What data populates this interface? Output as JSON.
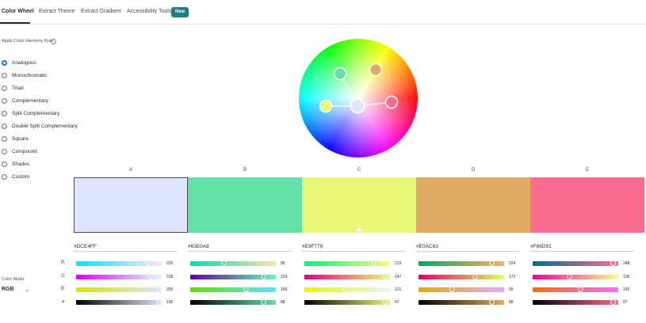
{
  "tabs": {
    "color_wheel": "Color Wheel",
    "extract_theme": "Extract Theme",
    "extract_gradient": "Extract Gradient",
    "accessibility_tools": "Accessibility Tools",
    "new_badge": "New"
  },
  "harmony": {
    "label": "Apply Color Harmony Rule",
    "info": "i",
    "selected": "Analogous",
    "rules": [
      "Analogous",
      "Monochromatic",
      "Triad",
      "Complementary",
      "Split Complementary",
      "Double Split Complementary",
      "Square",
      "Compound",
      "Shades",
      "Custom"
    ]
  },
  "swatches": [
    {
      "label": "A",
      "hex": "#DCE4FF",
      "color": "#DCE4FF",
      "rgb": [
        220,
        228,
        255
      ],
      "brightness": 100,
      "selected": true
    },
    {
      "label": "B",
      "hex": "#63E0A8",
      "color": "#63E0A8",
      "rgb": [
        99,
        224,
        168
      ],
      "brightness": 88,
      "selected": false
    },
    {
      "label": "C",
      "hex": "#E9F779",
      "color": "#E9F779",
      "rgb": [
        213,
        247,
        121
      ],
      "brightness": 97,
      "selected": false
    },
    {
      "label": "D",
      "hex": "#E0AC63",
      "color": "#E0AC63",
      "rgb": [
        224,
        172,
        99
      ],
      "brightness": 88,
      "selected": false
    },
    {
      "label": "E",
      "hex": "#F86D91",
      "color": "#F86D91",
      "rgb": [
        248,
        109,
        145
      ],
      "brightness": 97,
      "selected": false
    }
  ],
  "channels": [
    "R",
    "G",
    "B",
    "☀"
  ],
  "color_mode": {
    "label": "Color Mode",
    "value": "RGB",
    "chevron": "⌄"
  },
  "colors": {
    "accent": "#1473E6",
    "badge": "#1A7F84"
  }
}
